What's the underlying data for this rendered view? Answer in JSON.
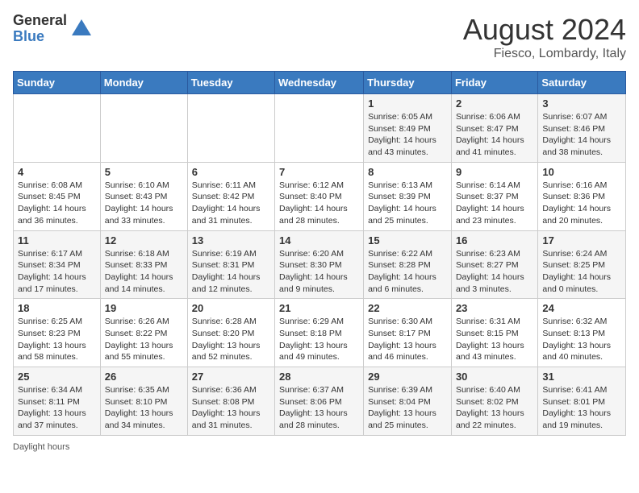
{
  "header": {
    "logo_general": "General",
    "logo_blue": "Blue",
    "month_year": "August 2024",
    "location": "Fiesco, Lombardy, Italy"
  },
  "days_of_week": [
    "Sunday",
    "Monday",
    "Tuesday",
    "Wednesday",
    "Thursday",
    "Friday",
    "Saturday"
  ],
  "weeks": [
    [
      {
        "day": "",
        "info": ""
      },
      {
        "day": "",
        "info": ""
      },
      {
        "day": "",
        "info": ""
      },
      {
        "day": "",
        "info": ""
      },
      {
        "day": "1",
        "info": "Sunrise: 6:05 AM\nSunset: 8:49 PM\nDaylight: 14 hours and 43 minutes."
      },
      {
        "day": "2",
        "info": "Sunrise: 6:06 AM\nSunset: 8:47 PM\nDaylight: 14 hours and 41 minutes."
      },
      {
        "day": "3",
        "info": "Sunrise: 6:07 AM\nSunset: 8:46 PM\nDaylight: 14 hours and 38 minutes."
      }
    ],
    [
      {
        "day": "4",
        "info": "Sunrise: 6:08 AM\nSunset: 8:45 PM\nDaylight: 14 hours and 36 minutes."
      },
      {
        "day": "5",
        "info": "Sunrise: 6:10 AM\nSunset: 8:43 PM\nDaylight: 14 hours and 33 minutes."
      },
      {
        "day": "6",
        "info": "Sunrise: 6:11 AM\nSunset: 8:42 PM\nDaylight: 14 hours and 31 minutes."
      },
      {
        "day": "7",
        "info": "Sunrise: 6:12 AM\nSunset: 8:40 PM\nDaylight: 14 hours and 28 minutes."
      },
      {
        "day": "8",
        "info": "Sunrise: 6:13 AM\nSunset: 8:39 PM\nDaylight: 14 hours and 25 minutes."
      },
      {
        "day": "9",
        "info": "Sunrise: 6:14 AM\nSunset: 8:37 PM\nDaylight: 14 hours and 23 minutes."
      },
      {
        "day": "10",
        "info": "Sunrise: 6:16 AM\nSunset: 8:36 PM\nDaylight: 14 hours and 20 minutes."
      }
    ],
    [
      {
        "day": "11",
        "info": "Sunrise: 6:17 AM\nSunset: 8:34 PM\nDaylight: 14 hours and 17 minutes."
      },
      {
        "day": "12",
        "info": "Sunrise: 6:18 AM\nSunset: 8:33 PM\nDaylight: 14 hours and 14 minutes."
      },
      {
        "day": "13",
        "info": "Sunrise: 6:19 AM\nSunset: 8:31 PM\nDaylight: 14 hours and 12 minutes."
      },
      {
        "day": "14",
        "info": "Sunrise: 6:20 AM\nSunset: 8:30 PM\nDaylight: 14 hours and 9 minutes."
      },
      {
        "day": "15",
        "info": "Sunrise: 6:22 AM\nSunset: 8:28 PM\nDaylight: 14 hours and 6 minutes."
      },
      {
        "day": "16",
        "info": "Sunrise: 6:23 AM\nSunset: 8:27 PM\nDaylight: 14 hours and 3 minutes."
      },
      {
        "day": "17",
        "info": "Sunrise: 6:24 AM\nSunset: 8:25 PM\nDaylight: 14 hours and 0 minutes."
      }
    ],
    [
      {
        "day": "18",
        "info": "Sunrise: 6:25 AM\nSunset: 8:23 PM\nDaylight: 13 hours and 58 minutes."
      },
      {
        "day": "19",
        "info": "Sunrise: 6:26 AM\nSunset: 8:22 PM\nDaylight: 13 hours and 55 minutes."
      },
      {
        "day": "20",
        "info": "Sunrise: 6:28 AM\nSunset: 8:20 PM\nDaylight: 13 hours and 52 minutes."
      },
      {
        "day": "21",
        "info": "Sunrise: 6:29 AM\nSunset: 8:18 PM\nDaylight: 13 hours and 49 minutes."
      },
      {
        "day": "22",
        "info": "Sunrise: 6:30 AM\nSunset: 8:17 PM\nDaylight: 13 hours and 46 minutes."
      },
      {
        "day": "23",
        "info": "Sunrise: 6:31 AM\nSunset: 8:15 PM\nDaylight: 13 hours and 43 minutes."
      },
      {
        "day": "24",
        "info": "Sunrise: 6:32 AM\nSunset: 8:13 PM\nDaylight: 13 hours and 40 minutes."
      }
    ],
    [
      {
        "day": "25",
        "info": "Sunrise: 6:34 AM\nSunset: 8:11 PM\nDaylight: 13 hours and 37 minutes."
      },
      {
        "day": "26",
        "info": "Sunrise: 6:35 AM\nSunset: 8:10 PM\nDaylight: 13 hours and 34 minutes."
      },
      {
        "day": "27",
        "info": "Sunrise: 6:36 AM\nSunset: 8:08 PM\nDaylight: 13 hours and 31 minutes."
      },
      {
        "day": "28",
        "info": "Sunrise: 6:37 AM\nSunset: 8:06 PM\nDaylight: 13 hours and 28 minutes."
      },
      {
        "day": "29",
        "info": "Sunrise: 6:39 AM\nSunset: 8:04 PM\nDaylight: 13 hours and 25 minutes."
      },
      {
        "day": "30",
        "info": "Sunrise: 6:40 AM\nSunset: 8:02 PM\nDaylight: 13 hours and 22 minutes."
      },
      {
        "day": "31",
        "info": "Sunrise: 6:41 AM\nSunset: 8:01 PM\nDaylight: 13 hours and 19 minutes."
      }
    ]
  ],
  "footer": {
    "note": "Daylight hours"
  }
}
